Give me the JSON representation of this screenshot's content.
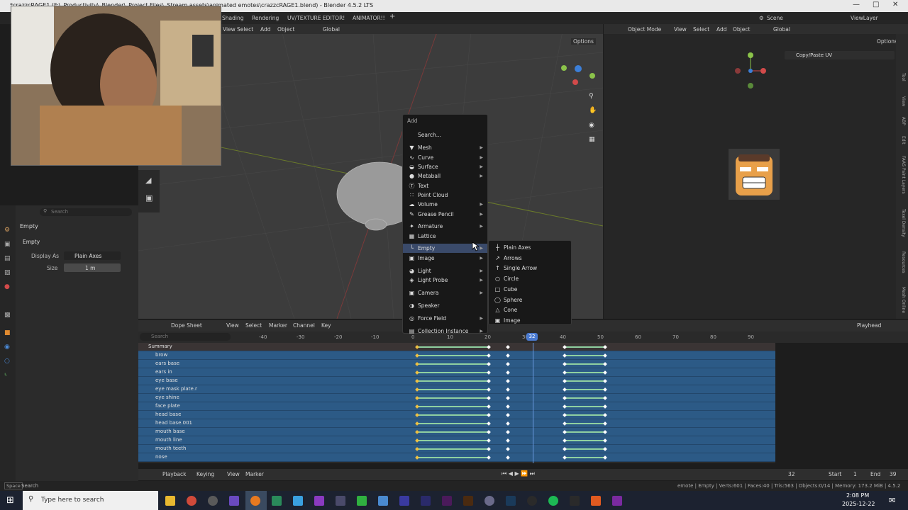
{
  "window": {
    "title": "*crazzcRAGE1 (F:\\_Productivity\\_Blender\\_Project Files\\_Stream assets\\animated emotes\\crazzcRAGE1.blend) - Blender 4.5.2 LTS"
  },
  "workspace_tabs": [
    "Shading",
    "Rendering",
    "UV/TEXTURE EDITOR!",
    "ANIMATOR!!"
  ],
  "topbar_right": {
    "scene": "Scene",
    "view_layer": "ViewLayer"
  },
  "viewport_header": {
    "view": "View",
    "select": "Select",
    "add": "Add",
    "object": "Object",
    "orientation": "Global",
    "options": "Options"
  },
  "uv_header": {
    "mode": "Object Mode",
    "view": "View",
    "select": "Select",
    "add": "Add",
    "object": "Object",
    "orientation": "Global",
    "options": "Options"
  },
  "uv_panel": {
    "copy_paste": "Copy/Paste UV"
  },
  "uv_side_tabs": [
    "Tool",
    "View",
    "ABP",
    "Edit",
    "FAAS Paint Layers",
    "Texel Density",
    "Resources",
    "Mesh Online"
  ],
  "properties": {
    "search_placeholder": "Search",
    "object_name": "Empty",
    "section": "Empty",
    "display_as_label": "Display As",
    "display_as_value": "Plain Axes",
    "size_label": "Size",
    "size_value": "1 m"
  },
  "add_menu": {
    "title": "Add",
    "items": [
      {
        "label": "Search...",
        "icon": "search-icon",
        "sub": false
      },
      {
        "label": "Mesh",
        "icon": "mesh-icon",
        "sub": true
      },
      {
        "label": "Curve",
        "icon": "curve-icon",
        "sub": true
      },
      {
        "label": "Surface",
        "icon": "surface-icon",
        "sub": true
      },
      {
        "label": "Metaball",
        "icon": "metaball-icon",
        "sub": true
      },
      {
        "label": "Text",
        "icon": "text-icon",
        "sub": false
      },
      {
        "label": "Point Cloud",
        "icon": "point-cloud-icon",
        "sub": false
      },
      {
        "label": "Volume",
        "icon": "volume-icon",
        "sub": true
      },
      {
        "label": "Grease Pencil",
        "icon": "grease-pencil-icon",
        "sub": true
      },
      {
        "label": "Armature",
        "icon": "armature-icon",
        "sub": true
      },
      {
        "label": "Lattice",
        "icon": "lattice-icon",
        "sub": false
      },
      {
        "label": "Empty",
        "icon": "empty-icon",
        "sub": true
      },
      {
        "label": "Image",
        "icon": "image-icon",
        "sub": true
      },
      {
        "label": "Light",
        "icon": "light-icon",
        "sub": true
      },
      {
        "label": "Light Probe",
        "icon": "light-probe-icon",
        "sub": true
      },
      {
        "label": "Camera",
        "icon": "camera-icon",
        "sub": true
      },
      {
        "label": "Speaker",
        "icon": "speaker-icon",
        "sub": false
      },
      {
        "label": "Force Field",
        "icon": "force-field-icon",
        "sub": true
      },
      {
        "label": "Collection Instance",
        "icon": "collection-icon",
        "sub": true
      }
    ]
  },
  "empty_submenu": {
    "items": [
      "Plain Axes",
      "Arrows",
      "Single Arrow",
      "Circle",
      "Cube",
      "Sphere",
      "Cone",
      "Image"
    ]
  },
  "dope_sheet": {
    "mode": "Dope Sheet",
    "menus": [
      "View",
      "Select",
      "Marker",
      "Channel",
      "Key"
    ],
    "search_placeholder": "Search",
    "playhead_label": "Playhead",
    "ruler": [
      "-40",
      "-30",
      "-20",
      "-10",
      "0",
      "10",
      "20",
      "30",
      "40",
      "50",
      "60",
      "70",
      "80",
      "90"
    ],
    "current_frame": "32",
    "channels": [
      "Summary",
      "brow",
      "ears base",
      "ears in",
      "eye base",
      "eye mask plate.r",
      "eye shine",
      "face plate",
      "head base",
      "head base.001",
      "mouth base",
      "mouth line",
      "mouth teeth",
      "nose"
    ]
  },
  "timeline": {
    "menus": [
      "Playback",
      "Keying",
      "View",
      "Marker"
    ],
    "frame": "32",
    "start_label": "Start",
    "start": "1",
    "end_label": "End",
    "end": "39"
  },
  "statusbar": {
    "left": "Space",
    "left2": "Search",
    "right": "emote | Empty | Verts:601 | Faces:40 | Tris:563 | Objects:0/14 | Memory: 173.2 MiB | 4.5.2"
  },
  "taskbar": {
    "search_placeholder": "Type here to search",
    "time": "2:08 PM",
    "date": "2025-12-22"
  }
}
